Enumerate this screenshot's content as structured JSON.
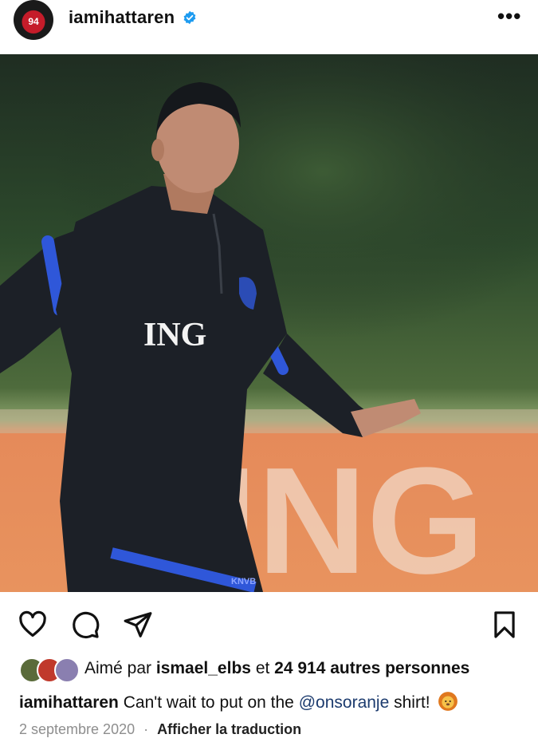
{
  "post": {
    "username": "iamihattaren",
    "avatar_number": "94",
    "photo": {
      "jersey_text": "ING",
      "banner_text": "ING",
      "shorts_text": "KNVB"
    },
    "likes": {
      "prefix": "Aimé par",
      "liker": "ismael_elbs",
      "connector": "et",
      "count_text": "24 914 autres personnes"
    },
    "caption": {
      "username": "iamihattaren",
      "text_before": "Can't wait to put on the",
      "mention": "@onsoranje",
      "text_after": "shirt!"
    },
    "date": "2 septembre 2020",
    "separator": "·",
    "translate_label": "Afficher la traduction",
    "more_label": "•••"
  },
  "colors": {
    "verified": "#1d9bf0",
    "mention": "#1c3b6e",
    "meta": "#8e8e8e",
    "banner": "#e58a5a",
    "jersey": "#1c2027",
    "accent_blue": "#2f57d9"
  },
  "icons": [
    "like-heart-icon",
    "comment-icon",
    "share-icon",
    "save-bookmark-icon",
    "verified-badge-icon",
    "more-options-icon",
    "lion-emoji-icon"
  ]
}
